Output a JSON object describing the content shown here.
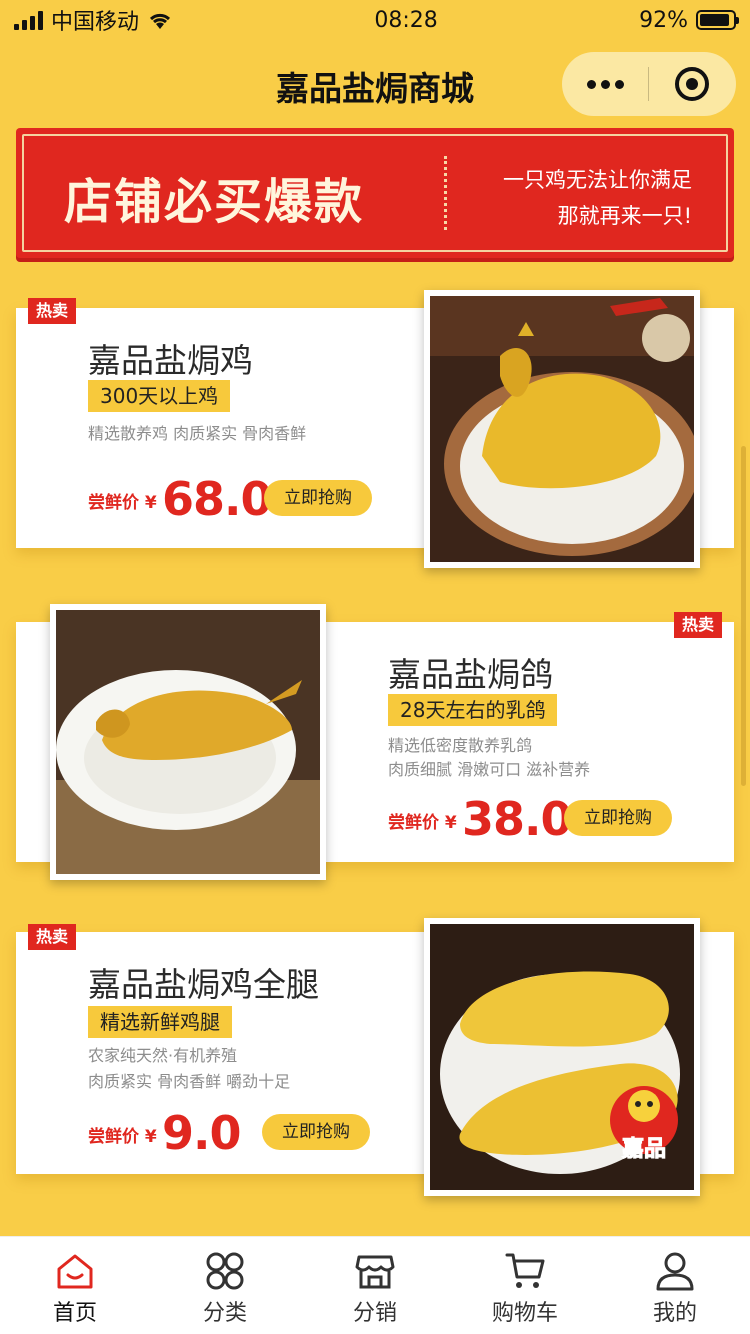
{
  "status": {
    "carrier": "中国移动",
    "time": "08:28",
    "battery": "92%",
    "battery_level": 0.92
  },
  "nav": {
    "title": "嘉品盐焗商城"
  },
  "banner": {
    "title": "店铺必买爆款",
    "subtitle_1": "一只鸡无法让你满足",
    "subtitle_2": "那就再来一只!"
  },
  "products": [
    {
      "tag": "热卖",
      "name": "嘉品盐焗鸡",
      "badge": "300天以上鸡",
      "desc_1": "精选散养鸡  肉质紧实  骨肉香鲜",
      "desc_2": "",
      "price_label": "尝鲜价 ¥",
      "price": "68.0",
      "button": "立即抢购"
    },
    {
      "tag": "热卖",
      "name": "嘉品盐焗鸽",
      "badge": "28天左右的乳鸽",
      "desc_1": "精选低密度散养乳鸽",
      "desc_2": "肉质细腻  滑嫩可口  滋补营养",
      "price_label": "尝鲜价 ¥",
      "price": "38.0",
      "button": "立即抢购"
    },
    {
      "tag": "热卖",
      "name": "嘉品盐焗鸡全腿",
      "badge": "精选新鲜鸡腿",
      "desc_1": "农家纯天然·有机养殖",
      "desc_2": "肉质紧实  骨肉香鲜  嚼劲十足",
      "price_label": "尝鲜价 ¥",
      "price": "9.0",
      "button": "立即抢购"
    }
  ],
  "logo_text": "嘉品",
  "tabs": [
    {
      "label": "首页",
      "icon": "home-icon",
      "active": true
    },
    {
      "label": "分类",
      "icon": "category-icon"
    },
    {
      "label": "分销",
      "icon": "store-icon"
    },
    {
      "label": "购物车",
      "icon": "cart-icon"
    },
    {
      "label": "我的",
      "icon": "user-icon"
    }
  ],
  "colors": {
    "background": "#f9cd47",
    "accent_red": "#e0271f",
    "badge_yellow": "#f7c93c",
    "active_tab": "#e0271f"
  }
}
